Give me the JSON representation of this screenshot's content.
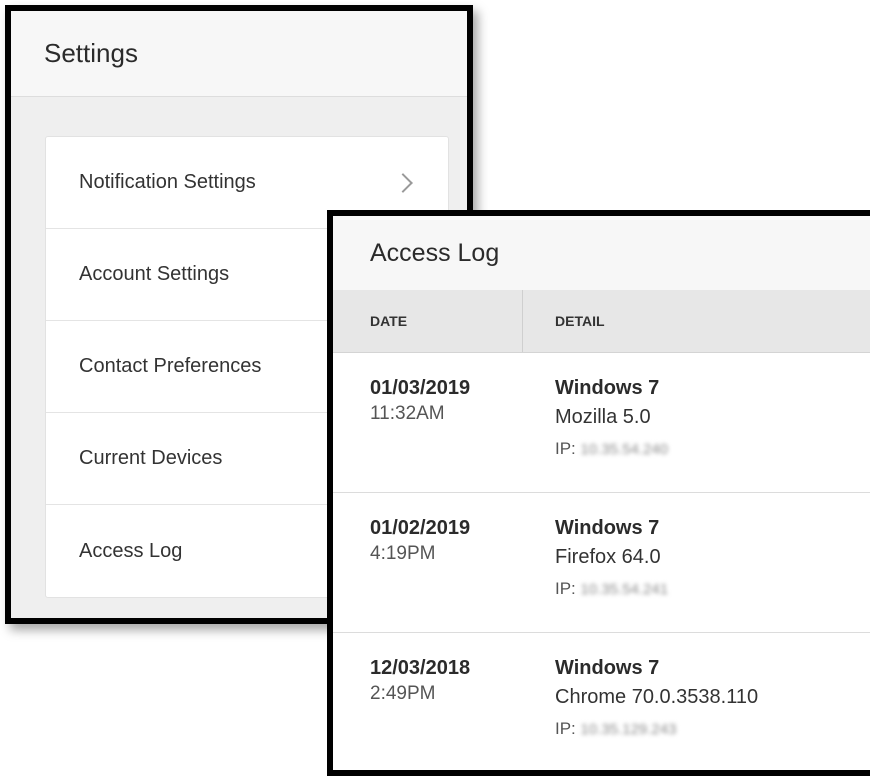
{
  "settings": {
    "title": "Settings",
    "menu": [
      {
        "label": "Notification Settings",
        "icon": "chevron-right-icon"
      },
      {
        "label": "Account Settings"
      },
      {
        "label": "Contact Preferences"
      },
      {
        "label": "Current Devices"
      },
      {
        "label": "Access Log"
      }
    ]
  },
  "access_log": {
    "title": "Access Log",
    "columns": [
      "DATE",
      "DETAIL"
    ],
    "ip_prefix": "IP:",
    "rows": [
      {
        "date": "01/03/2019",
        "time": "11:32AM",
        "os": "Windows 7",
        "browser": "Mozilla 5.0",
        "ip": "10.35.54.240"
      },
      {
        "date": "01/02/2019",
        "time": "4:19PM",
        "os": "Windows 7",
        "browser": "Firefox 64.0",
        "ip": "10.35.54.241"
      },
      {
        "date": "12/03/2018",
        "time": "2:49PM",
        "os": "Windows 7",
        "browser": "Chrome 70.0.3538.110",
        "ip": "10.35.129.243"
      }
    ]
  }
}
